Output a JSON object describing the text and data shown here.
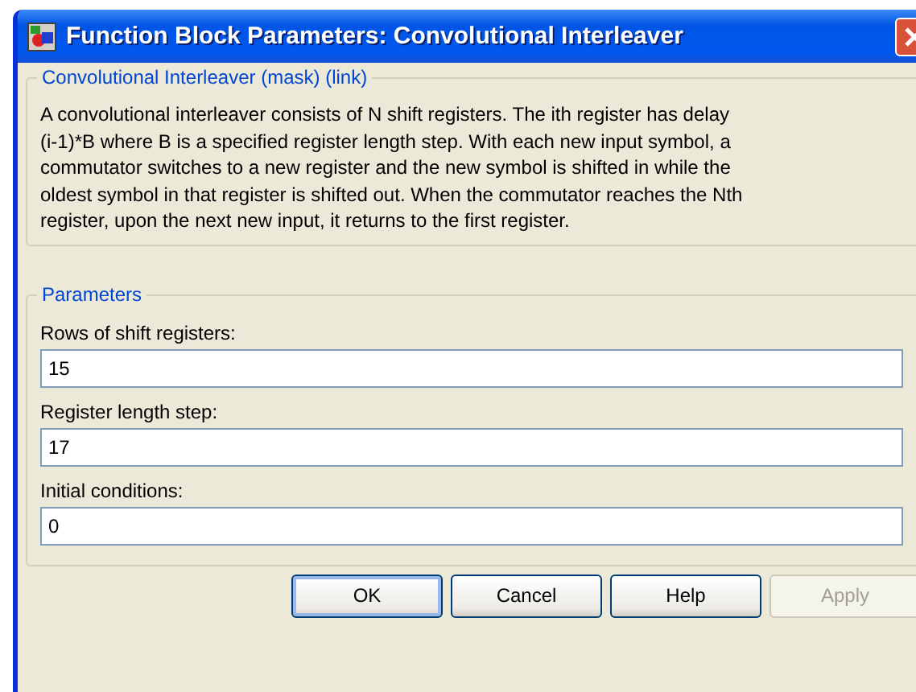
{
  "window": {
    "title": "Function Block Parameters: Convolutional Interleaver"
  },
  "description": {
    "heading": "Convolutional Interleaver (mask) (link)",
    "lines": [
      "A convolutional interleaver consists of N shift registers.  The ith register has delay",
      "(i-1)*B where B is a specified register length step.  With each new input symbol, a",
      "commutator switches to a new register and the new symbol is shifted in while the",
      "oldest symbol in that register is shifted out.  When the commutator reaches the Nth",
      "register, upon the next new input, it returns to the first register."
    ]
  },
  "parameters": {
    "heading": "Parameters",
    "fields": [
      {
        "label": "Rows of shift registers:",
        "value": "15"
      },
      {
        "label": "Register length step:",
        "value": "17"
      },
      {
        "label": "Initial conditions:",
        "value": "0"
      }
    ]
  },
  "buttons": [
    {
      "label": "OK",
      "disabled": false,
      "default": true
    },
    {
      "label": "Cancel",
      "disabled": false,
      "default": false
    },
    {
      "label": "Help",
      "disabled": false,
      "default": false
    },
    {
      "label": "Apply",
      "disabled": true,
      "default": false
    }
  ]
}
